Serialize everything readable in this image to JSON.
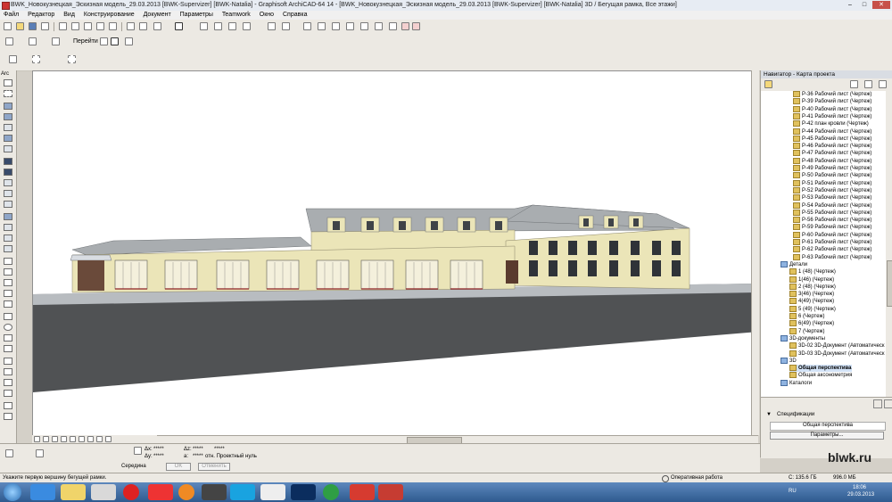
{
  "window": {
    "title": "BWK_Новокузнецкая_Эскизная модель_29.03.2013  [BWK-Supervizer]  [BWK-Natalia]  - Graphisoft ArchiCAD-64 14 - [BWK_Новокузнецкая_Эскизная модель_29.03.2013  [BWK-Supervizer]  [BWK-Natalia] 3D / Бегущая рамка, Все этажи]"
  },
  "menu": [
    "Файл",
    "Редактор",
    "Вид",
    "Конструирование",
    "Документ",
    "Параметры",
    "Teamwork",
    "Окно",
    "Справка"
  ],
  "toolbar2": {
    "goto_label": "Перейти"
  },
  "toolbox": {
    "title": "Arc"
  },
  "navigator": {
    "title": "Навигатор - Карта проекта",
    "items": [
      "P-36 Рабочий лист (Чертеж)",
      "P-39 Рабочий лист (Чертеж)",
      "P-40 Рабочий лист (Чертеж)",
      "P-41 Рабочий лист (Чертеж)",
      "P-42 план кровли (Чертеж)",
      "P-44 Рабочий лист (Чертеж)",
      "P-45 Рабочий лист (Чертеж)",
      "P-46 Рабочий лист (Чертеж)",
      "P-47 Рабочий лист (Чертеж)",
      "P-48 Рабочий лист (Чертеж)",
      "P-49 Рабочий лист (Чертеж)",
      "P-50 Рабочий лист (Чертеж)",
      "P-51 Рабочий лист (Чертеж)",
      "P-52 Рабочий лист (Чертеж)",
      "P-53 Рабочий лист (Чертеж)",
      "P-54 Рабочий лист (Чертеж)",
      "P-55 Рабочий лист (Чертеж)",
      "P-56 Рабочий лист (Чертеж)",
      "P-59 Рабочий лист (Чертеж)",
      "P-60 Рабочий лист (Чертеж)",
      "P-61 Рабочий лист (Чертеж)",
      "P-62 Рабочий лист (Чертеж)",
      "P-63 Рабочий лист (Чертеж)"
    ],
    "details_folder": "Детали",
    "details": [
      "1 (48) (Чертеж)",
      "1(46) (Чертеж)",
      "2 (48) (Чертеж)",
      "3(46) (Чертеж)",
      "4(49) (Чертеж)",
      "5 (49) (Чертеж)",
      "6 (Чертеж)",
      "6(49) (Чертеж)",
      "7 (Чертеж)"
    ],
    "docs3d_folder": "3D-документы",
    "docs3d": [
      "3D-02 3D-Документ (Автоматическ",
      "3D-03 3D-Документ (Автоматическ"
    ],
    "folder_3d": "3D",
    "items_3d": [
      "Общая перспектива",
      "Общая аксонометрия"
    ],
    "catalogs_folder": "Каталоги",
    "specs_label": "Спецификации",
    "view_name": "Общая перспектива",
    "params_button": "Параметры..."
  },
  "infobox": {
    "dx_label": "Δx:",
    "dx_value": "*****",
    "dy_label": "Δy:",
    "dy_value": "*****",
    "dz_label": "Δz:",
    "dz_value": "*****",
    "a_label": "a:",
    "a_value": "*****",
    "from_label": "отн. Проектный нуль",
    "snap_label": "Середина",
    "ok_button": "OK",
    "cancel_button": "Отменить",
    "top_value": "*****"
  },
  "statusbar": {
    "hint": "Укажите первую вершину бегущей рамки.",
    "mode": "Оперативная работа",
    "disk": "С: 135.6 ГБ",
    "memory": "996.0 МБ"
  },
  "watermark": "blwk.ru",
  "taskbar": {
    "lang": "RU",
    "time": "18:06",
    "date": "29.03.2013"
  },
  "colors": {
    "facade": "#ebe5b8",
    "roof": "#a9adb0",
    "ground": "#505254",
    "plinth": "#b8bcc0",
    "accent_red": "#8d2226"
  }
}
